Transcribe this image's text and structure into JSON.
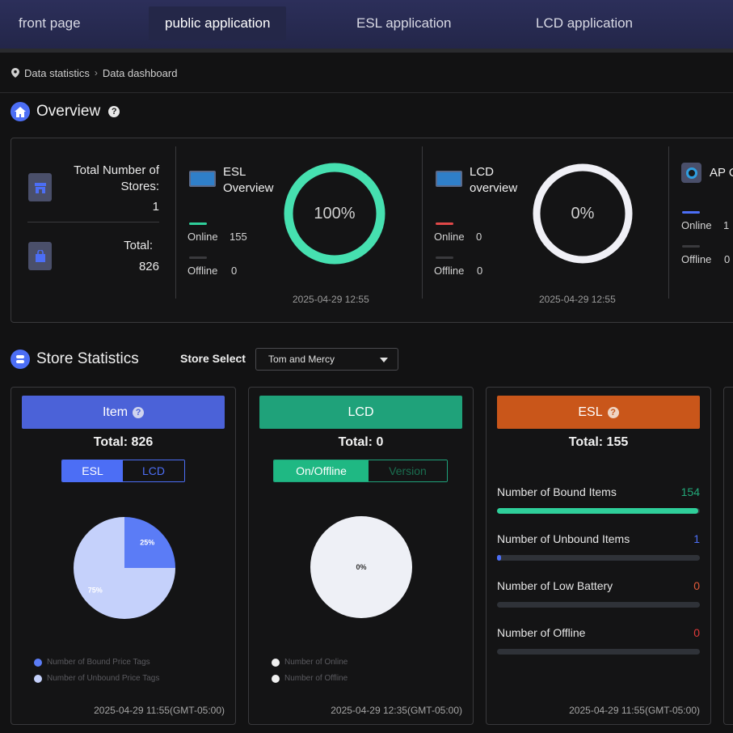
{
  "nav": {
    "items": [
      {
        "label": "front page"
      },
      {
        "label": "public application"
      },
      {
        "label": "ESL application"
      },
      {
        "label": "LCD application"
      }
    ]
  },
  "breadcrumb": {
    "first": "Data statistics",
    "second": "Data dashboard"
  },
  "overview": {
    "title": "Overview",
    "stores_label_1": "Total Number of",
    "stores_label_2": "Stores:",
    "stores_value": "1",
    "total_label": "Total:",
    "total_value": "826",
    "esl": {
      "title_1": "ESL",
      "title_2": "Overview",
      "online_label": "Online",
      "online_value": "155",
      "offline_label": "Offline",
      "offline_value": "0",
      "percent": "100%",
      "percent_value": 100,
      "timestamp": "2025-04-29 12:55"
    },
    "lcd": {
      "title_1": "LCD",
      "title_2": "overview",
      "online_label": "Online",
      "online_value": "0",
      "offline_label": "Offline",
      "offline_value": "0",
      "percent": "0%",
      "percent_value": 0,
      "timestamp": "2025-04-29 12:55"
    },
    "ap": {
      "title": "AP O",
      "online_label": "Online",
      "online_value": "1",
      "offline_label": "Offline",
      "offline_value": "0"
    }
  },
  "store_stats": {
    "title": "Store Statistics",
    "select_label": "Store Select",
    "select_value": "Tom and Mercy"
  },
  "item_panel": {
    "title": "Item",
    "total": "Total: 826",
    "tab_esl": "ESL",
    "tab_lcd": "LCD",
    "legend_bound": "Number of Bound Price Tags",
    "legend_unbound": "Number of Unbound Price Tags",
    "timestamp": "2025-04-29 11:55(GMT-05:00)"
  },
  "lcd_panel": {
    "title": "LCD",
    "total": "Total: 0",
    "tab_online": "On/Offline",
    "tab_version": "Version",
    "pie_label": "0%",
    "legend_online": "Number of Online",
    "legend_offline": "Number of Offline",
    "timestamp": "2025-04-29 12:35(GMT-05:00)"
  },
  "esl_panel": {
    "title": "ESL",
    "total": "Total: 155",
    "timestamp": "2025-04-29 11:55(GMT-05:00)",
    "stats": [
      {
        "label": "Number of Bound Items",
        "value": "154",
        "ratio": 0.99,
        "color": "#2fcf9a",
        "value_color": "#22a878"
      },
      {
        "label": "Number of Unbound Items",
        "value": "1",
        "ratio": 0.01,
        "color": "#4c6ef5",
        "value_color": "#4c6ef5"
      },
      {
        "label": "Number of Low Battery",
        "value": "0",
        "ratio": 0,
        "color": "#e05a3a",
        "value_color": "#e05a3a"
      },
      {
        "label": "Number of Offline",
        "value": "0",
        "ratio": 0,
        "color": "#e03a3a",
        "value_color": "#e03a3a"
      }
    ]
  },
  "chart_data": {
    "type": "pie",
    "title": "",
    "categories": [
      "Number of Bound Price Tags",
      "Number of Unbound Price Tags"
    ],
    "values": [
      25,
      75
    ],
    "labels": [
      "25%",
      "75%"
    ],
    "colors": [
      "#5b7cf6",
      "#c5d1fb"
    ]
  }
}
